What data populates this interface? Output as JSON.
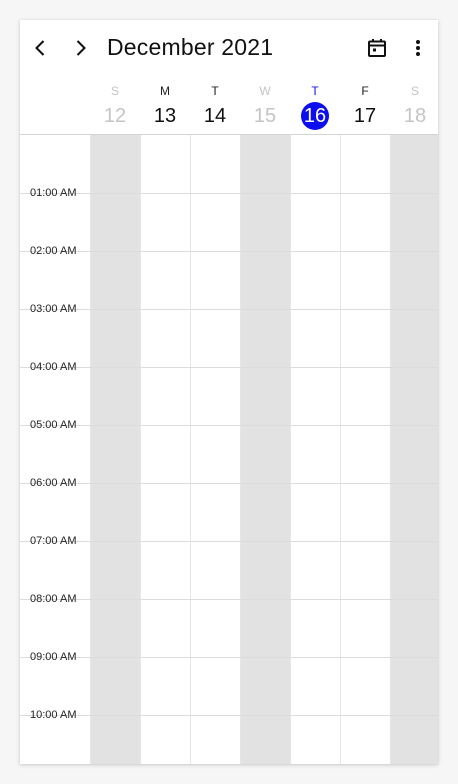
{
  "header": {
    "title": "December 2021",
    "prev_icon": "chevron-left-icon",
    "next_icon": "chevron-right-icon",
    "today_icon": "calendar-today-icon",
    "menu_icon": "more-vertical-icon"
  },
  "days": [
    {
      "letter": "S",
      "num": "12",
      "state": "disabled"
    },
    {
      "letter": "M",
      "num": "13",
      "state": "normal"
    },
    {
      "letter": "T",
      "num": "14",
      "state": "normal"
    },
    {
      "letter": "W",
      "num": "15",
      "state": "disabled"
    },
    {
      "letter": "T",
      "num": "16",
      "state": "today"
    },
    {
      "letter": "F",
      "num": "17",
      "state": "normal"
    },
    {
      "letter": "S",
      "num": "18",
      "state": "disabled"
    }
  ],
  "time_slots": [
    "01:00 AM",
    "02:00 AM",
    "03:00 AM",
    "04:00 AM",
    "05:00 AM",
    "06:00 AM",
    "07:00 AM",
    "08:00 AM",
    "09:00 AM",
    "10:00 AM"
  ],
  "colors": {
    "today": "#0c0ef0",
    "nonworking": "#e2e2e2",
    "disabled_text": "#c4c4c4"
  }
}
